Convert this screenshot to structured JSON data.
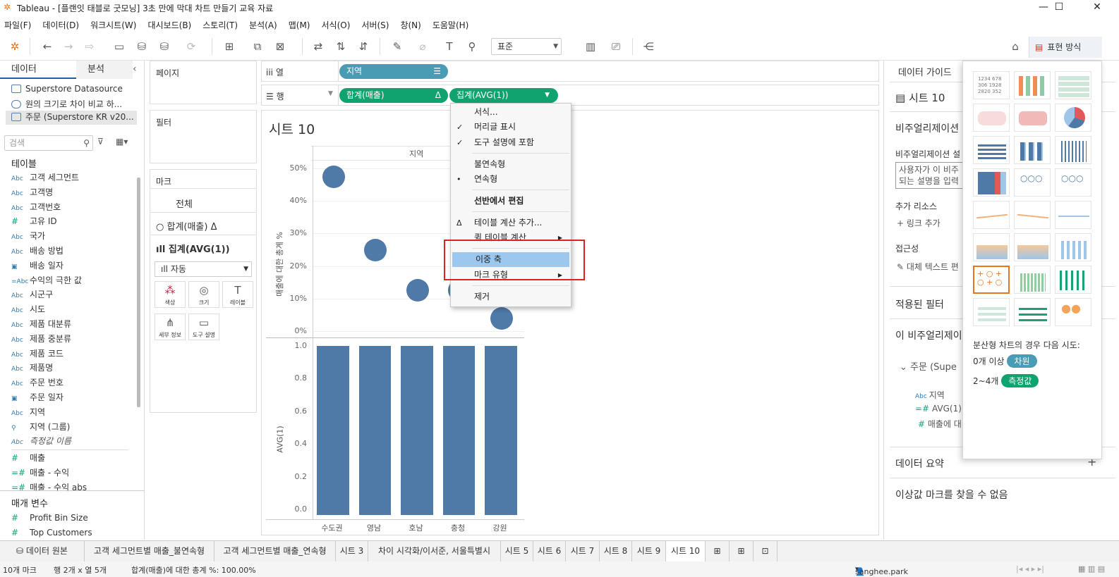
{
  "window": {
    "title": "Tableau - [플랜잇 태블로 굿모닝] 3초 만에 막대 차트 만들기 교육 자료"
  },
  "menu": [
    "파일(F)",
    "데이터(D)",
    "워크시트(W)",
    "대시보드(B)",
    "스토리(T)",
    "분석(A)",
    "맵(M)",
    "서식(O)",
    "서버(S)",
    "창(N)",
    "도움말(H)"
  ],
  "toolbar": {
    "fit_value": "표준",
    "format_label": "표현 방식"
  },
  "left": {
    "tab_data": "데이터",
    "tab_analysis": "분석",
    "datasources": [
      "Superstore Datasource",
      "원의 크기로 차이 비교 하...",
      "주문 (Superstore KR v20..."
    ],
    "search_placeholder": "검색",
    "tables_header": "테이블",
    "fields": [
      {
        "t": "Abc",
        "n": "고객 세그먼트"
      },
      {
        "t": "Abc",
        "n": "고객명"
      },
      {
        "t": "Abc",
        "n": "고객번호"
      },
      {
        "t": "#",
        "n": "고유 ID"
      },
      {
        "t": "Abc",
        "n": "국가"
      },
      {
        "t": "Abc",
        "n": "배송 방법"
      },
      {
        "t": "cal",
        "n": "배송 일자"
      },
      {
        "t": "=Abc",
        "n": "수익의 극한 값"
      },
      {
        "t": "Abc",
        "n": "시군구"
      },
      {
        "t": "Abc",
        "n": "시도"
      },
      {
        "t": "Abc",
        "n": "제품 대분류"
      },
      {
        "t": "Abc",
        "n": "제품 중분류"
      },
      {
        "t": "Abc",
        "n": "제품 코드"
      },
      {
        "t": "Abc",
        "n": "제품명"
      },
      {
        "t": "Abc",
        "n": "주문 번호"
      },
      {
        "t": "cal",
        "n": "주문 일자"
      },
      {
        "t": "Abc",
        "n": "지역"
      },
      {
        "t": "clip",
        "n": "지역 (그룹)"
      },
      {
        "t": "Abc",
        "n": "측정값 이름"
      }
    ],
    "measures": [
      {
        "t": "#",
        "n": "매출"
      },
      {
        "t": "=#",
        "n": "매출 - 수익"
      },
      {
        "t": "=#",
        "n": "매출 - 수익 abs"
      }
    ],
    "params_header": "매개 변수",
    "params": [
      "Profit Bin Size",
      "Top Customers"
    ]
  },
  "cards": {
    "pages": "페이지",
    "filters": "필터",
    "marks": "마크",
    "marks_all": "전체",
    "marks_sum": "합계(매출) Δ",
    "marks_avg": "집계(AVG(1))",
    "mark_type": "자동",
    "buttons": [
      "색상",
      "크기",
      "레이블",
      "세부 정보",
      "도구 설명"
    ]
  },
  "shelves": {
    "columns_label": "열",
    "rows_label": "행",
    "col_pill": "지역",
    "row_pill1": "합계(매출)",
    "row_pill2": "집계(AVG(1))"
  },
  "view": {
    "sheet_title": "시트 10",
    "header": "지역",
    "top_ylabel": "매출에 대한 총계 %",
    "bottom_ylabel": "AVG(1)"
  },
  "chart_data": [
    {
      "type": "scatter",
      "title": "",
      "xlabel": "",
      "ylabel": "매출에 대한 총계 %",
      "categories": [
        "수도권",
        "영남",
        "호남",
        "충청",
        "강원"
      ],
      "values": [
        47.5,
        24.8,
        12.5,
        12.5,
        4.0
      ],
      "ylim": [
        0,
        50
      ],
      "y_ticks": [
        "0%",
        "10%",
        "20%",
        "30%",
        "40%",
        "50%"
      ]
    },
    {
      "type": "bar",
      "title": "",
      "xlabel": "",
      "ylabel": "AVG(1)",
      "categories": [
        "수도권",
        "영남",
        "호남",
        "충청",
        "강원"
      ],
      "values": [
        1.0,
        1.0,
        1.0,
        1.0,
        1.0
      ],
      "ylim": [
        0,
        1.0
      ],
      "y_ticks": [
        "0.0",
        "0.2",
        "0.4",
        "0.6",
        "0.8",
        "1.0"
      ]
    }
  ],
  "context_menu": {
    "items": [
      "서식...",
      "머리글 표시",
      "도구 설명에 포함",
      "불연속형",
      "연속형",
      "선반에서 편집",
      "테이블 계산 추가...",
      "퀵 테이블 계산",
      "이중 축",
      "마크 유형",
      "제거"
    ],
    "highlighted": "이중 축"
  },
  "right": {
    "guide_title": "데이터 가이드",
    "sheet": "시트 10",
    "viz_header": "비주얼리제이션",
    "viz_desc_label": "비주얼리제이션 설",
    "viz_desc_placeholder_1": "사용자가 이 비주",
    "viz_desc_placeholder_2": "되는 설명을 입력",
    "resources": "추가 리소스",
    "add_link": "링크 추가",
    "access": "접근성",
    "alt_text": "대체 텍스트 편",
    "applied_filters": "적용된 필터",
    "this_viz": "이 비주얼리제이",
    "source": "주문 (Supe",
    "f1": "지역",
    "f2": "AVG(1)",
    "f3": "매출에 대",
    "summary": "데이터 요약",
    "outlier": "이상값 마크를 찾을 수 없음"
  },
  "showme": {
    "hint": "분산형 차트의 경우 다음 시도:",
    "r1_prefix": "0개 이상",
    "r1_chip": "차원",
    "r2_prefix": "2~4개",
    "r2_chip": "측정값",
    "colors": {
      "dim": "#4a9bb4",
      "meas": "#11a36f"
    }
  },
  "bottom": {
    "tabs": [
      "데이터 원본",
      "고객 세그먼트별 매출_불연속형",
      "고객 세그먼트별 매출_연속형",
      "시트 3",
      "차이 시각화/이서준, 서울특별시",
      "시트 5",
      "시트 6",
      "시트 7",
      "시트 8",
      "시트 9",
      "시트 10"
    ],
    "status_marks": "10개 마크",
    "status_rc": "행 2개 x 열 5개",
    "status_sum": "합계(매출)에 대한 총계 %: 100.00%",
    "user": "sanghee.park"
  }
}
